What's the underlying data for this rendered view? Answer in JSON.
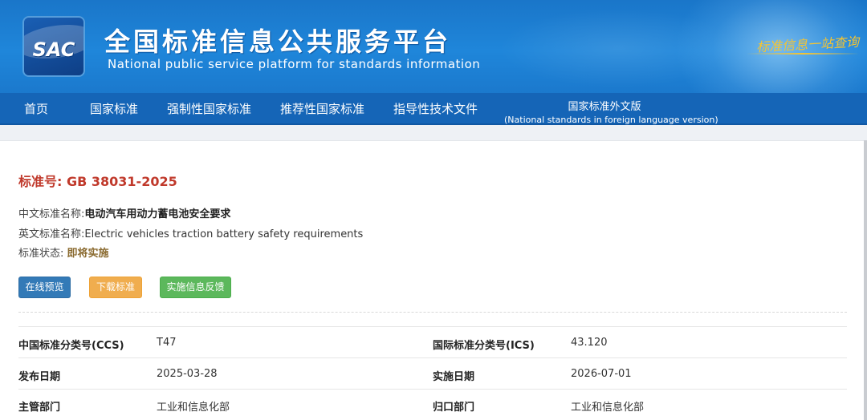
{
  "header": {
    "logo_text": "SAC",
    "title_cn": "全国标准信息公共服务平台",
    "title_en": "National public service platform  for standards information",
    "slogan": "标准信息一站查询"
  },
  "nav": {
    "items": [
      {
        "label": "首页"
      },
      {
        "label": "国家标准"
      },
      {
        "label": "强制性国家标准"
      },
      {
        "label": "推荐性国家标准"
      },
      {
        "label": "指导性技术文件"
      }
    ],
    "foreign": {
      "label": "国家标准外文版",
      "sub": "(National standards in foreign language version)"
    }
  },
  "standard": {
    "number_label": "标准号:",
    "number": "GB 38031-2025",
    "cn_name_label": "中文标准名称:",
    "cn_name": "电动汽车用动力蓄电池安全要求",
    "en_name_label": "英文标准名称:",
    "en_name": "Electric vehicles traction battery safety requirements",
    "status_label": "标准状态:",
    "status": "即将实施"
  },
  "buttons": {
    "preview": "在线预览",
    "download": "下载标准",
    "feedback": "实施信息反馈"
  },
  "details": {
    "ccs_label": "中国标准分类号(CCS)",
    "ccs": "T47",
    "ics_label": "国际标准分类号(ICS)",
    "ics": "43.120",
    "publish_label": "发布日期",
    "publish": "2025-03-28",
    "implement_label": "实施日期",
    "implement": "2026-07-01",
    "dept_label": "主管部门",
    "dept": "工业和信息化部",
    "owner_label": "归口部门",
    "owner": "工业和信息化部"
  },
  "colors": {
    "banner": "#1f86da",
    "nav": "#1565b7",
    "std_no": "#c0392b",
    "btn_blue": "#337ab7",
    "btn_orange": "#f0ad4e",
    "btn_green": "#5cb85c"
  }
}
